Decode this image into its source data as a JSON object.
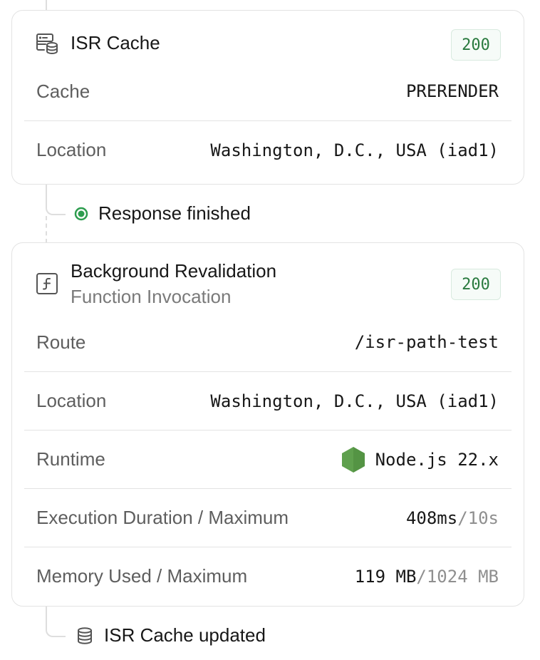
{
  "isr_cache_card": {
    "title": "ISR Cache",
    "status": "200",
    "icon": "server-database-icon",
    "rows": [
      {
        "label": "Cache",
        "value": "PRERENDER"
      },
      {
        "label": "Location",
        "value": "Washington, D.C., USA (iad1)"
      }
    ]
  },
  "response_event": {
    "label": "Response finished",
    "status_color": "#2e9d4f"
  },
  "revalidation_card": {
    "title": "Background Revalidation",
    "subtitle": "Function Invocation",
    "status": "200",
    "icon": "function-icon",
    "route": {
      "label": "Route",
      "value": "/isr-path-test"
    },
    "location": {
      "label": "Location",
      "value": "Washington, D.C., USA (iad1)"
    },
    "runtime": {
      "label": "Runtime",
      "value": "Node.js 22.x",
      "icon": "nodejs-icon"
    },
    "duration": {
      "label": "Execution Duration / Maximum",
      "used": "408ms",
      "max": "/10s"
    },
    "memory": {
      "label": "Memory Used / Maximum",
      "used": "119 MB",
      "max": "/1024 MB"
    }
  },
  "cache_updated_event": {
    "label": "ISR Cache updated",
    "icon": "database-icon"
  },
  "colors": {
    "border": "#e3e3e3",
    "badge_text": "#2a7a3f",
    "node_green": "#5fa04e"
  }
}
